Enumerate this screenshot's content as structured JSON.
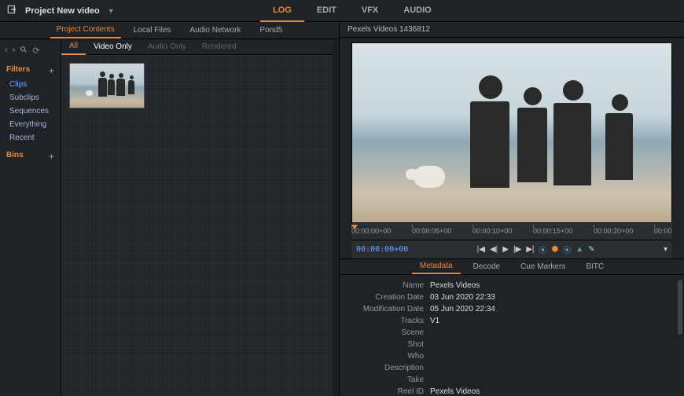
{
  "header": {
    "project_title": "Project New video",
    "tabs": [
      "LOG",
      "EDIT",
      "VFX",
      "AUDIO"
    ],
    "active_tab": "LOG"
  },
  "left_panel": {
    "tabs": [
      "Project Contents",
      "Local Files",
      "Audio Network",
      "Pond5"
    ],
    "active_tab": "Project Contents",
    "sub_tabs": [
      "All",
      "Video Only",
      "Audio Only",
      "Rendered"
    ],
    "active_sub_tab": "All",
    "selected_sub_tab": "Video Only",
    "sidebar": {
      "filters_title": "Filters",
      "filter_items": [
        "Clips",
        "Subclips",
        "Sequences",
        "Everything",
        "Recent"
      ],
      "active_filter": "Clips",
      "bins_title": "Bins"
    }
  },
  "viewer": {
    "clip_name": "Pexels Videos 1436812",
    "timecodes": [
      "00:00:00+00",
      "00:00:05+00",
      "00:00:10+00",
      "00:00:15+00",
      "00:00:20+00",
      "00:00"
    ],
    "current_tc": "00:00:00+00"
  },
  "metadata": {
    "tabs": [
      "Metadata",
      "Decode",
      "Cue Markers",
      "BITC"
    ],
    "active_tab": "Metadata",
    "rows": [
      {
        "label": "Name",
        "value": "Pexels Videos"
      },
      {
        "label": "Creation Date",
        "value": "03 Jun 2020  22:33"
      },
      {
        "label": "Modification Date",
        "value": "05 Jun 2020  22:34"
      },
      {
        "label": "Tracks",
        "value": "V1"
      },
      {
        "label": "Scene",
        "value": ""
      },
      {
        "label": "Shot",
        "value": ""
      },
      {
        "label": "Who",
        "value": ""
      },
      {
        "label": "Description",
        "value": ""
      },
      {
        "label": "Take",
        "value": ""
      },
      {
        "label": "Reel ID",
        "value": "Pexels Videos"
      }
    ]
  }
}
